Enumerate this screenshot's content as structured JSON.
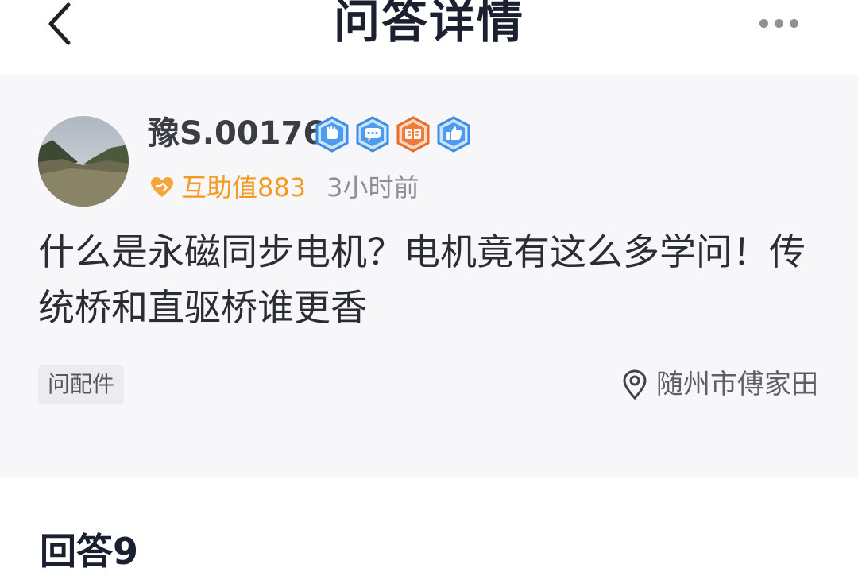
{
  "header": {
    "title": "问答详情"
  },
  "question_card": {
    "username": "豫S.00176",
    "badges": [
      {
        "name": "fist-badge-icon",
        "color": "#3a8ee6"
      },
      {
        "name": "chat-badge-icon",
        "color": "#3a8ee6"
      },
      {
        "name": "book-badge-icon",
        "color": "#e86c2a"
      },
      {
        "name": "thumb-up-badge-icon",
        "color": "#3a8ee6"
      }
    ],
    "help_value": "互助值883",
    "time": "3小时前",
    "question_text": "什么是永磁同步电机？电机竟有这么多学问！传统桥和直驱桥谁更香",
    "tag": "问配件",
    "location": "随州市傅家田"
  },
  "answers": {
    "title": "回答9"
  },
  "colors": {
    "accent_orange": "#f39a23",
    "card_background": "#f7f7f9",
    "title_text": "#1b2030"
  }
}
